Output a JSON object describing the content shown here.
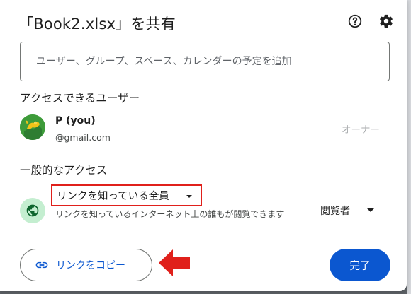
{
  "dialog": {
    "title": "「Book2.xlsx」を共有",
    "help_icon": "help-circle-icon",
    "settings_icon": "gear-icon"
  },
  "search": {
    "placeholder": "ユーザー、グループ、スペース、カレンダーの予定を追加",
    "value": ""
  },
  "people_section": {
    "heading": "アクセスできるユーザー",
    "people": [
      {
        "name": "P (you)",
        "email": "@gmail.com",
        "role": "オーナー",
        "avatar_icon": "avatar-icon"
      }
    ]
  },
  "general_access": {
    "heading": "一般的なアクセス",
    "icon": "globe-icon",
    "selected_option": "リンクを知っている全員",
    "description": "リンクを知っているインターネット上の誰もが閲覧できます",
    "role_selected": "閲覧者"
  },
  "footer": {
    "copy_link_label": "リンクをコピー",
    "copy_link_icon": "link-icon",
    "done_label": "完了"
  },
  "colors": {
    "primary": "#0b57d0",
    "highlight_border": "#e0201b",
    "annotation_arrow": "#e0201b",
    "globe_bg": "#c4eed0",
    "owner_text": "#a8abad"
  }
}
